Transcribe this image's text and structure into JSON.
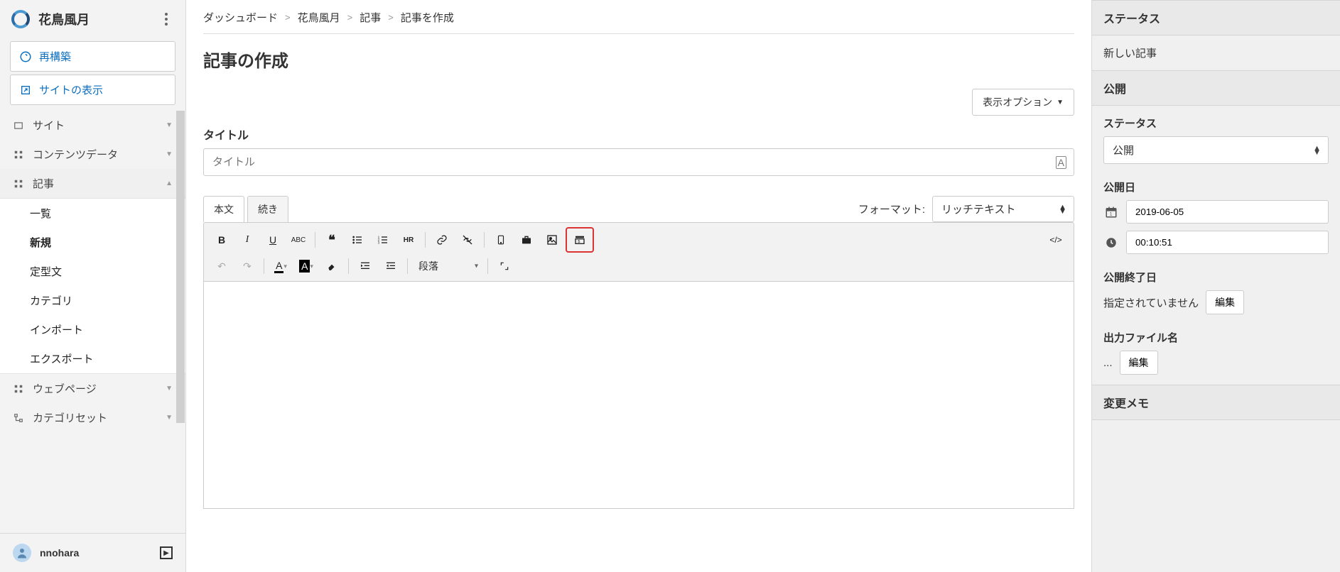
{
  "brand": {
    "name": "花鳥風月"
  },
  "sidebar": {
    "rebuild": "再構築",
    "viewSite": "サイトの表示",
    "site": "サイト",
    "contentData": "コンテンツデータ",
    "articles": "記事",
    "sub": {
      "list": "一覧",
      "new": "新規",
      "boilerplate": "定型文",
      "category": "カテゴリ",
      "import": "インポート",
      "export": "エクスポート"
    },
    "webpage": "ウェブページ",
    "categorySet": "カテゴリセット"
  },
  "user": {
    "name": "nnohara"
  },
  "breadcrumb": {
    "dashboard": "ダッシュボード",
    "site": "花鳥風月",
    "articles": "記事",
    "create": "記事を作成"
  },
  "page": {
    "title": "記事の作成",
    "displayOptions": "表示オプション"
  },
  "titleField": {
    "label": "タイトル",
    "placeholder": "タイトル"
  },
  "editor": {
    "tabs": {
      "body": "本文",
      "more": "続き"
    },
    "formatLabel": "フォーマット:",
    "formatValue": "リッチテキスト",
    "paragraph": "段落"
  },
  "right": {
    "statusHeader": "ステータス",
    "newArticle": "新しい記事",
    "publishHeader": "公開",
    "statusLabel": "ステータス",
    "statusValue": "公開",
    "pubDateLabel": "公開日",
    "pubDate": "2019-06-05",
    "pubTime": "00:10:51",
    "endDateLabel": "公開終了日",
    "endDateNone": "指定されていません",
    "edit": "編集",
    "outputFileLabel": "出力ファイル名",
    "outputFileNone": "...",
    "changeMemoLabel": "変更メモ"
  }
}
